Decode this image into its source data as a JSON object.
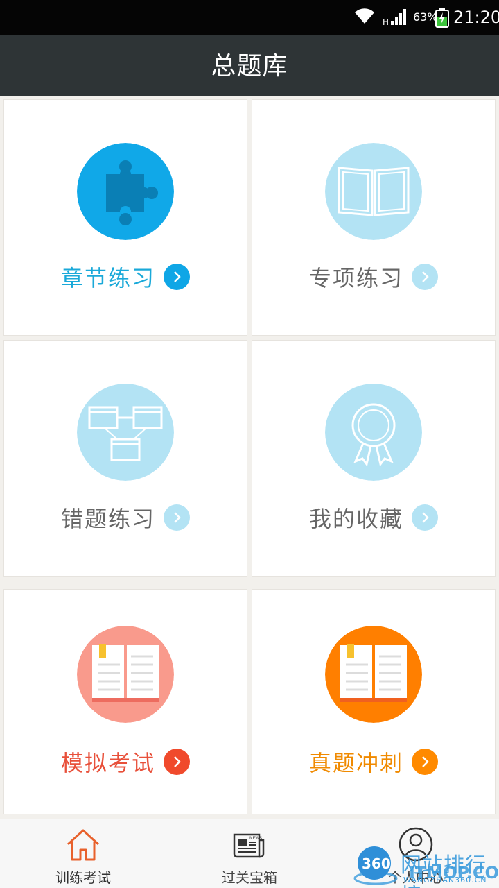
{
  "status_bar": {
    "battery_percent": "63%",
    "time": "21:20",
    "network_type": "H"
  },
  "header": {
    "title": "总题库"
  },
  "cards": [
    {
      "label": "章节练习",
      "label_color": "#1aa9d9",
      "icon_bg": "#10a8e8",
      "arrow_bg": "#0fa6e6",
      "icon": "puzzle-icon"
    },
    {
      "label": "专项练习",
      "label_color": "#666666",
      "icon_bg": "#b3e3f4",
      "arrow_bg": "#b3e3f4",
      "icon": "open-book-icon"
    },
    {
      "label": "错题练习",
      "label_color": "#666666",
      "icon_bg": "#b3e3f4",
      "arrow_bg": "#b3e3f4",
      "icon": "flowchart-icon"
    },
    {
      "label": "我的收藏",
      "label_color": "#666666",
      "icon_bg": "#b3e3f4",
      "arrow_bg": "#b3e3f4",
      "icon": "award-ribbon-icon"
    },
    {
      "label": "模拟考试",
      "label_color": "#e8503a",
      "icon_bg": "#f99a8c",
      "arrow_bg": "#f04a2c",
      "icon": "bookmarked-book-icon"
    },
    {
      "label": "真题冲刺",
      "label_color": "#f08a00",
      "icon_bg": "#ff7f00",
      "arrow_bg": "#ff8a00",
      "icon": "bookmarked-book-icon"
    }
  ],
  "tab_bar": {
    "tabs": [
      {
        "label": "训练考试",
        "icon": "home-icon",
        "active": true
      },
      {
        "label": "过关宝箱",
        "icon": "news-icon",
        "active": false
      },
      {
        "label": "个人中心",
        "icon": "user-icon",
        "active": false
      }
    ]
  },
  "watermark": {
    "badge": "360",
    "text": "网站排行榜",
    "overlay": "ITMOP.COM",
    "sub": "WANGZHAN360.CN"
  }
}
